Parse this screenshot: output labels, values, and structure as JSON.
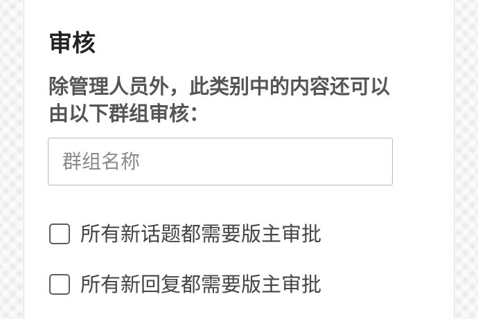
{
  "moderation": {
    "title": "审核",
    "description": "除管理人员外，此类别中的内容还可以由以下群组审核：",
    "group_input": {
      "placeholder": "群组名称",
      "value": ""
    },
    "options": [
      {
        "label": "所有新话题都需要版主审批",
        "checked": false
      },
      {
        "label": "所有新回复都需要版主审批",
        "checked": false
      }
    ]
  }
}
